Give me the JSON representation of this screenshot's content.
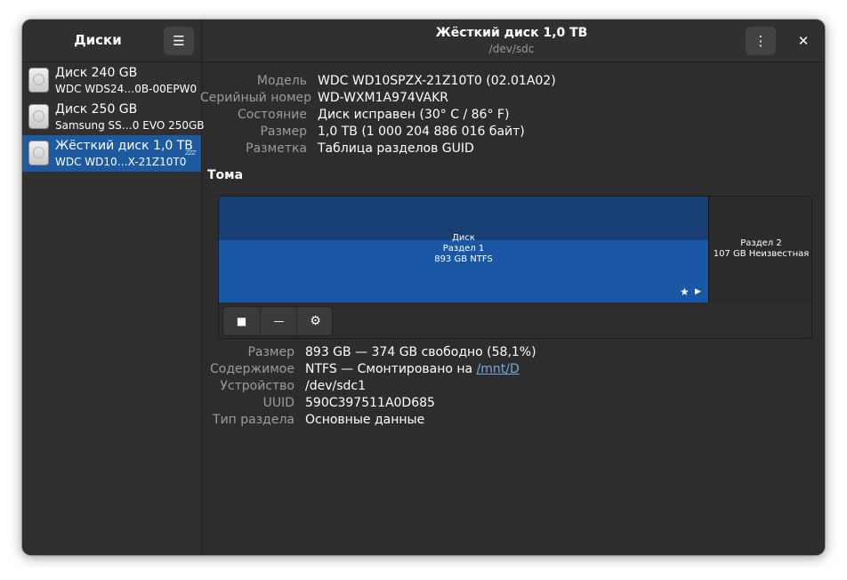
{
  "sidebar": {
    "title": "Диски",
    "menu_icon": "☰",
    "items": [
      {
        "name": "Диск 240 GB",
        "model": "WDC WDS24…0B-00EPW0"
      },
      {
        "name": "Диск 250 GB",
        "model": "Samsung SS…0 EVO 250GB"
      },
      {
        "name": "Жёсткий диск 1,0 TB",
        "model": "WDC WD10…X-21Z10T0",
        "sleep_icon": "zzz"
      }
    ]
  },
  "header": {
    "title": "Жёсткий диск 1,0 TB",
    "subtitle": "/dev/sdc",
    "kebab_icon": "⋮",
    "close_icon": "✕"
  },
  "drive_info": {
    "model_label": "Модель",
    "model_value": "WDC WD10SPZX-21Z10T0 (02.01A02)",
    "serial_label": "Серийный номер",
    "serial_value": "WD-WXM1A974VAKR",
    "state_label": "Состояние",
    "state_value": "Диск исправен (30° C / 86° F)",
    "size_label": "Размер",
    "size_value": "1,0 TB (1 000 204 886 016 байт)",
    "partitioning_label": "Разметка",
    "partitioning_value": "Таблица разделов GUID"
  },
  "volumes": {
    "title": "Тома",
    "partition1": {
      "line1": "Диск",
      "line2": "Раздел 1",
      "line3": "893 GB NTFS"
    },
    "partition2": {
      "line1": "Раздел 2",
      "line2": "107 GB Неизвестная"
    },
    "star_icon": "★",
    "play_icon": "▶",
    "toolbar": {
      "stop_icon": "■",
      "remove_icon": "—",
      "settings_icon": "⚙"
    }
  },
  "partition_info": {
    "size_label": "Размер",
    "size_value": "893 GB — 374 GB свободно (58,1%)",
    "contents_label": "Содержимое",
    "contents_prefix": "NTFS — Смонтировано на ",
    "contents_link": "/mnt/D",
    "device_label": "Устройство",
    "device_value": "/dev/sdc1",
    "uuid_label": "UUID",
    "uuid_value": "590C397511A0D685",
    "type_label": "Тип раздела",
    "type_value": "Основные данные"
  },
  "colors": {
    "accent": "#1e5aa0",
    "partition_fill": "#1a57a4",
    "window_bg": "#2d2d2d",
    "link": "#7aa6dd"
  }
}
